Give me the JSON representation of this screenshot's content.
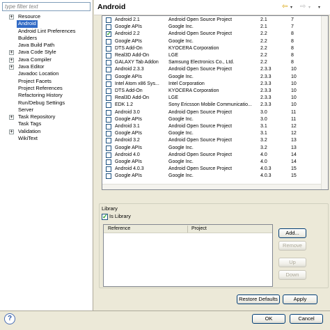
{
  "filter": {
    "placeholder": "type filter text"
  },
  "tree": [
    {
      "label": "Resource",
      "expandable": true,
      "selected": false
    },
    {
      "label": "Android",
      "expandable": false,
      "selected": true
    },
    {
      "label": "Android Lint Preferences",
      "expandable": false,
      "selected": false
    },
    {
      "label": "Builders",
      "expandable": false,
      "selected": false
    },
    {
      "label": "Java Build Path",
      "expandable": false,
      "selected": false
    },
    {
      "label": "Java Code Style",
      "expandable": true,
      "selected": false
    },
    {
      "label": "Java Compiler",
      "expandable": true,
      "selected": false
    },
    {
      "label": "Java Editor",
      "expandable": true,
      "selected": false
    },
    {
      "label": "Javadoc Location",
      "expandable": false,
      "selected": false
    },
    {
      "label": "Project Facets",
      "expandable": false,
      "selected": false
    },
    {
      "label": "Project References",
      "expandable": false,
      "selected": false
    },
    {
      "label": "Refactoring History",
      "expandable": false,
      "selected": false
    },
    {
      "label": "Run/Debug Settings",
      "expandable": false,
      "selected": false
    },
    {
      "label": "Server",
      "expandable": false,
      "selected": false
    },
    {
      "label": "Task Repository",
      "expandable": true,
      "selected": false
    },
    {
      "label": "Task Tags",
      "expandable": false,
      "selected": false
    },
    {
      "label": "Validation",
      "expandable": true,
      "selected": false
    },
    {
      "label": "WikiText",
      "expandable": false,
      "selected": false
    }
  ],
  "header": {
    "title": "Android"
  },
  "targets": [
    {
      "checked": false,
      "name": "Android 2.1",
      "vendor": "Android Open Source Project",
      "platform": "2.1",
      "api": "7"
    },
    {
      "checked": false,
      "name": "Google APIs",
      "vendor": "Google Inc.",
      "platform": "2.1",
      "api": "7"
    },
    {
      "checked": true,
      "name": "Android 2.2",
      "vendor": "Android Open Source Project",
      "platform": "2.2",
      "api": "8"
    },
    {
      "checked": false,
      "name": "Google APIs",
      "vendor": "Google Inc.",
      "platform": "2.2",
      "api": "8"
    },
    {
      "checked": false,
      "name": "DTS Add-On",
      "vendor": "KYOCERA Corporation",
      "platform": "2.2",
      "api": "8"
    },
    {
      "checked": false,
      "name": "Real3D Add-On",
      "vendor": "LGE",
      "platform": "2.2",
      "api": "8"
    },
    {
      "checked": false,
      "name": "GALAXY Tab Addon",
      "vendor": "Samsung Electronics Co., Ltd.",
      "platform": "2.2",
      "api": "8"
    },
    {
      "checked": false,
      "name": "Android 2.3.3",
      "vendor": "Android Open Source Project",
      "platform": "2.3.3",
      "api": "10"
    },
    {
      "checked": false,
      "name": "Google APIs",
      "vendor": "Google Inc.",
      "platform": "2.3.3",
      "api": "10"
    },
    {
      "checked": false,
      "name": "Intel Atom x86 Sys...",
      "vendor": "Intel Corporation",
      "platform": "2.3.3",
      "api": "10"
    },
    {
      "checked": false,
      "name": "DTS Add-On",
      "vendor": "KYOCERA Corporation",
      "platform": "2.3.3",
      "api": "10"
    },
    {
      "checked": false,
      "name": "Real3D Add-On",
      "vendor": "LGE",
      "platform": "2.3.3",
      "api": "10"
    },
    {
      "checked": false,
      "name": "EDK 1.2",
      "vendor": "Sony Ericsson Mobile Communicatio...",
      "platform": "2.3.3",
      "api": "10"
    },
    {
      "checked": false,
      "name": "Android 3.0",
      "vendor": "Android Open Source Project",
      "platform": "3.0",
      "api": "11"
    },
    {
      "checked": false,
      "name": "Google APIs",
      "vendor": "Google Inc.",
      "platform": "3.0",
      "api": "11"
    },
    {
      "checked": false,
      "name": "Android 3.1",
      "vendor": "Android Open Source Project",
      "platform": "3.1",
      "api": "12"
    },
    {
      "checked": false,
      "name": "Google APIs",
      "vendor": "Google Inc.",
      "platform": "3.1",
      "api": "12"
    },
    {
      "checked": false,
      "name": "Android 3.2",
      "vendor": "Android Open Source Project",
      "platform": "3.2",
      "api": "13"
    },
    {
      "checked": false,
      "name": "Google APIs",
      "vendor": "Google Inc.",
      "platform": "3.2",
      "api": "13"
    },
    {
      "checked": false,
      "name": "Android 4.0",
      "vendor": "Android Open Source Project",
      "platform": "4.0",
      "api": "14"
    },
    {
      "checked": false,
      "name": "Google APIs",
      "vendor": "Google Inc.",
      "platform": "4.0",
      "api": "14"
    },
    {
      "checked": false,
      "name": "Android 4.0.3",
      "vendor": "Android Open Source Project",
      "platform": "4.0.3",
      "api": "15"
    },
    {
      "checked": false,
      "name": "Google APIs",
      "vendor": "Google Inc.",
      "platform": "4.0.3",
      "api": "15"
    }
  ],
  "library": {
    "group_label": "Library",
    "is_library_label": "Is Library",
    "is_library_checked": true,
    "columns": [
      "Reference",
      "Project"
    ],
    "add_label": "Add...",
    "remove_label": "Remove",
    "up_label": "Up",
    "down_label": "Down"
  },
  "buttons": {
    "restore_defaults": "Restore Defaults",
    "apply": "Apply",
    "ok": "OK",
    "cancel": "Cancel"
  },
  "icons": {
    "help": "help-icon",
    "back": "back-arrow-icon",
    "forward": "forward-arrow-icon"
  }
}
